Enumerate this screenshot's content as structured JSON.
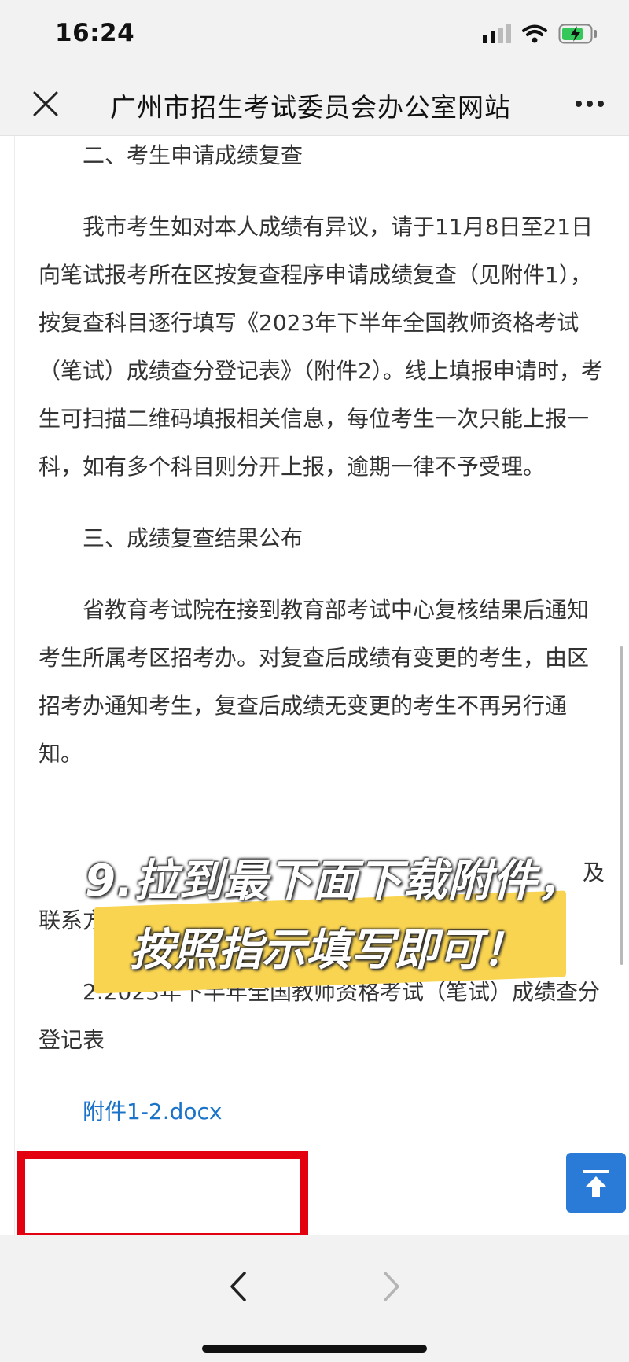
{
  "status": {
    "time": "16:24"
  },
  "header": {
    "title": "广州市招生考试委员会办公室网站",
    "close_icon": "close-icon",
    "more_icon": "more-icon"
  },
  "article": {
    "section2_heading": "二、考生申请成绩复查",
    "section2_body": "我市考生如对本人成绩有异议，请于11月8日至21日向笔试报考所在区按复查程序申请成绩复查（见附件1），按复查科目逐行填写《2023年下半年全国教师资格考试（笔试）成绩查分登记表》（附件2）。线上填报申请时，考生可扫描二维码填报相关信息，每位考生一次只能上报一科，如有多个科目则分开上报，逾期一律不予受理。",
    "section3_heading": "三、成绩复查结果公布",
    "section3_body": "省教育考试院在接到教育部考试中心复核结果后通知考生所属考区招考办。对复查后成绩有变更的考生，由区招考办通知考生，复查后成绩无变更的考生不再另行通知。",
    "attachment1_tail": "及",
    "attachment1_line2": "联系方式",
    "attachment2": "2.2023年下半年全国教师资格考试（笔试）成绩查分登记表",
    "attachment_link": "附件1-2.docx"
  },
  "overlay": {
    "line1": "9.拉到最下面下载附件，",
    "line2": "按照指示填写即可！",
    "highlight_color": "#f9d451",
    "box_color": "#e3000f"
  },
  "bottom_nav": {
    "back_icon": "chevron-left-icon",
    "forward_icon": "chevron-right-icon"
  },
  "back_to_top_icon": "arrow-up-to-line-icon"
}
